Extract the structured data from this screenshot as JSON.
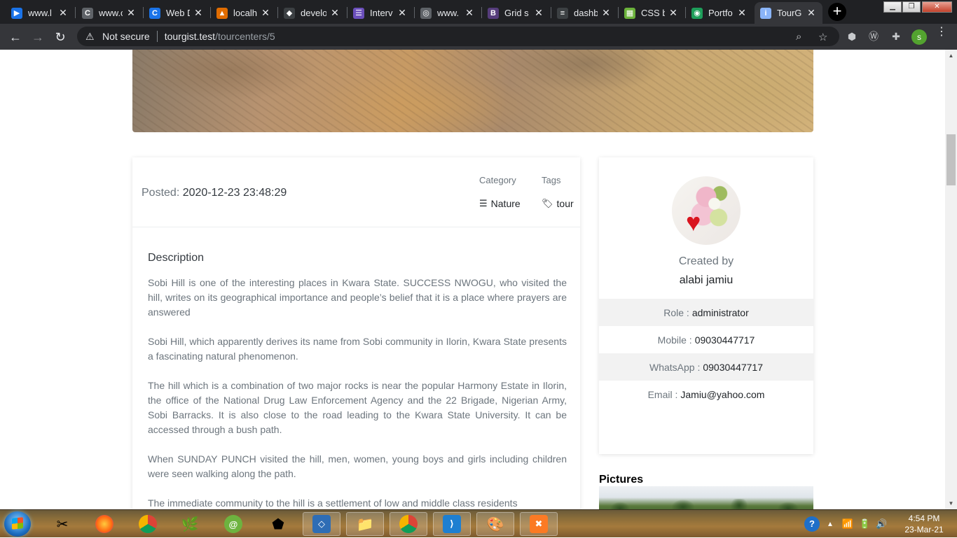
{
  "browser": {
    "tabs": [
      {
        "title": "www.l",
        "favicon_color": "#1a73e8",
        "favicon_glyph": "▶"
      },
      {
        "title": "www.c",
        "favicon_color": "#5f6368",
        "favicon_glyph": "C"
      },
      {
        "title": "Web D",
        "favicon_color": "#1a73e8",
        "favicon_glyph": "C"
      },
      {
        "title": "localh",
        "favicon_color": "#e06c00",
        "favicon_glyph": "▲"
      },
      {
        "title": "develo",
        "favicon_color": "#3c4043",
        "favicon_glyph": "◆"
      },
      {
        "title": "Interv",
        "favicon_color": "#6b4fbb",
        "favicon_glyph": "☰"
      },
      {
        "title": "www.",
        "favicon_color": "#5f6368",
        "favicon_glyph": "◎"
      },
      {
        "title": "Grid s",
        "favicon_color": "#563d7c",
        "favicon_glyph": "B"
      },
      {
        "title": "dashb",
        "favicon_color": "#3c4043",
        "favicon_glyph": "≡"
      },
      {
        "title": "CSS b",
        "favicon_color": "#6bb23b",
        "favicon_glyph": "▦"
      },
      {
        "title": "Portfo",
        "favicon_color": "#1e9e5a",
        "favicon_glyph": "◉"
      },
      {
        "title": "TourG",
        "favicon_color": "#8ab4f8",
        "favicon_glyph": "i",
        "active": true
      }
    ],
    "new_tab_glyph": "+",
    "window_controls": {
      "minimize": "▁",
      "maximize": "❐",
      "close": "✕"
    },
    "back_glyph": "←",
    "forward_glyph": "→",
    "reload_glyph": "↻",
    "security_label": "Not secure",
    "url_host": "tourgist.test",
    "url_path": "/tourcenters/5",
    "profile_initial": "s"
  },
  "post": {
    "posted_label": "Posted:",
    "posted_value": "2020-12-23 23:48:29",
    "category_label": "Category",
    "category_value": "Nature",
    "tags_label": "Tags",
    "tags_value": "tour",
    "description_title": "Description",
    "paragraphs": [
      "Sobi Hill is one of the interesting places in Kwara State. SUCCESS NWOGU, who visited the hill, writes on its geographical importance and people’s belief that it is a place where prayers are answered",
      "Sobi Hill, which apparently derives its name from Sobi community in Ilorin, Kwara State presents a fascinating natural phenomenon.",
      "The hill which is a combination of two major rocks is near the popular Harmony Estate in Ilorin, the office of the National Drug Law Enforcement Agency and the 22 Brigade, Nigerian Army, Sobi Barracks. It is also close to the road leading to the Kwara State University. It can be accessed through a bush path.",
      "When SUNDAY PUNCH visited the hill, men, women, young boys and girls including children were seen walking along the path.",
      "The immediate community to the hill is a settlement of low and middle class residents"
    ]
  },
  "creator": {
    "created_label": "Created by",
    "name": "alabi jamiu",
    "role_label": "Role :",
    "role_value": "administrator",
    "mobile_label": "Mobile :",
    "mobile_value": "09030447717",
    "whatsapp_label": "WhatsApp :",
    "whatsapp_value": "09030447717",
    "email_label": "Email :",
    "email_value": "Jamiu@yahoo.com"
  },
  "pictures": {
    "heading": "Pictures"
  },
  "taskbar": {
    "clock_time": "4:54 PM",
    "clock_date": "23-Mar-21"
  },
  "colors": {
    "accent": "#1a73e8",
    "page_text": "#6c757d",
    "dark_text": "#212529"
  }
}
